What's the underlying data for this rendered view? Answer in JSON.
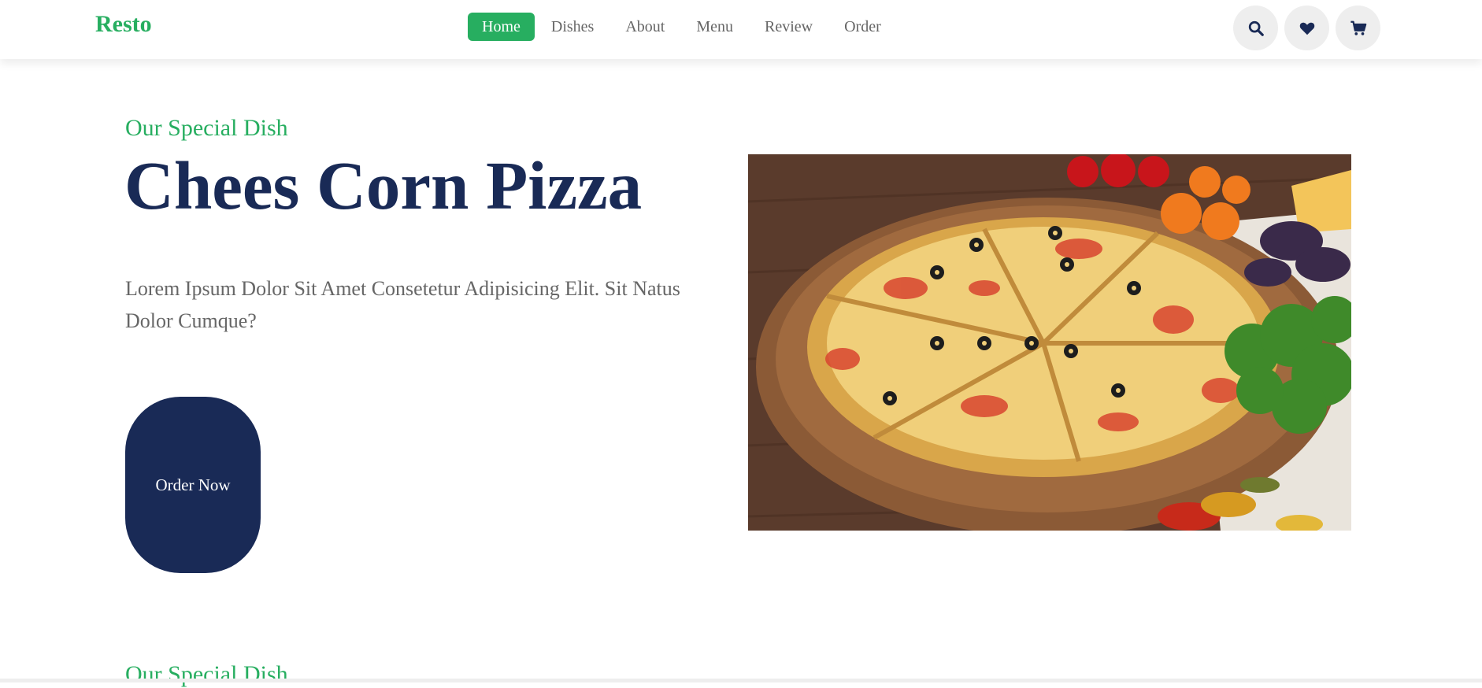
{
  "header": {
    "logo": "Resto",
    "nav": [
      {
        "label": "Home",
        "active": true
      },
      {
        "label": "Dishes",
        "active": false
      },
      {
        "label": "About",
        "active": false
      },
      {
        "label": "Menu",
        "active": false
      },
      {
        "label": "Review",
        "active": false
      },
      {
        "label": "Order",
        "active": false
      }
    ],
    "icons": [
      "search-icon",
      "heart-icon",
      "cart-icon"
    ]
  },
  "hero": {
    "eyebrow": "Our Special Dish",
    "title": "Chees Corn Pizza",
    "description": "Lorem Ipsum Dolor Sit Amet Consetetur Adipisicing Elit. Sit Natus Dolor Cumque?",
    "button_label": "Order Now",
    "image_subject": "pizza-photo"
  },
  "next_section": {
    "eyebrow": "Our Special Dish"
  },
  "colors": {
    "accent": "#27ae60",
    "primary": "#192a56",
    "text": "#666666",
    "icon_bg": "#eeeeee"
  }
}
